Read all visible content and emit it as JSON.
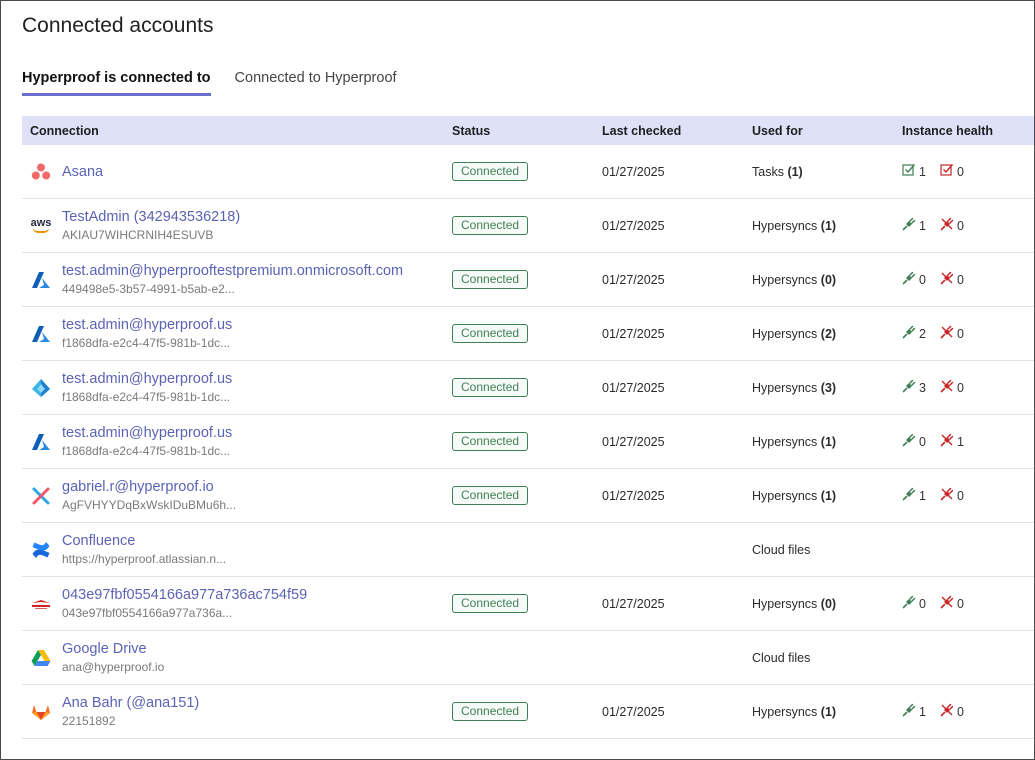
{
  "page": {
    "title": "Connected accounts"
  },
  "tabs": [
    {
      "label": "Hyperproof is connected to",
      "active": true
    },
    {
      "label": "Connected to Hyperproof",
      "active": false
    }
  ],
  "table": {
    "headers": {
      "connection": "Connection",
      "status": "Status",
      "last_checked": "Last checked",
      "used_for": "Used for",
      "instance_health": "Instance health"
    },
    "rows": [
      {
        "icon": "asana-icon",
        "name": "Asana",
        "sub": "",
        "status": "Connected",
        "last_checked": "01/27/2025",
        "used_for": "Tasks",
        "used_count": "(1)",
        "health_type": "tasks",
        "health_ok": "1",
        "health_err": "0"
      },
      {
        "icon": "aws-icon",
        "name": "TestAdmin (342943536218)",
        "sub": "AKIAU7WIHCRNIH4ESUVB",
        "status": "Connected",
        "last_checked": "01/27/2025",
        "used_for": "Hypersyncs",
        "used_count": "(1)",
        "health_type": "sync",
        "health_ok": "1",
        "health_err": "0"
      },
      {
        "icon": "azure-icon",
        "name": "test.admin@hyperprooftestpremium.onmicrosoft.com",
        "sub": "449498e5-3b57-4991-b5ab-e2...",
        "status": "Connected",
        "last_checked": "01/27/2025",
        "used_for": "Hypersyncs",
        "used_count": "(0)",
        "health_type": "sync",
        "health_ok": "0",
        "health_err": "0"
      },
      {
        "icon": "azure-icon",
        "name": "test.admin@hyperproof.us",
        "sub": "f1868dfa-e2c4-47f5-981b-1dc...",
        "status": "Connected",
        "last_checked": "01/27/2025",
        "used_for": "Hypersyncs",
        "used_count": "(2)",
        "health_type": "sync",
        "health_ok": "2",
        "health_err": "0"
      },
      {
        "icon": "azure-ad-icon",
        "name": "test.admin@hyperproof.us",
        "sub": "f1868dfa-e2c4-47f5-981b-1dc...",
        "status": "Connected",
        "last_checked": "01/27/2025",
        "used_for": "Hypersyncs",
        "used_count": "(3)",
        "health_type": "sync",
        "health_ok": "3",
        "health_err": "0"
      },
      {
        "icon": "azure-icon",
        "name": "test.admin@hyperproof.us",
        "sub": "f1868dfa-e2c4-47f5-981b-1dc...",
        "status": "Connected",
        "last_checked": "01/27/2025",
        "used_for": "Hypersyncs",
        "used_count": "(1)",
        "health_type": "sync",
        "health_ok": "0",
        "health_err": "1"
      },
      {
        "icon": "cross-logo-icon",
        "name": "gabriel.r@hyperproof.io",
        "sub": "AgFVHYYDqBxWskIDuBMu6h...",
        "status": "Connected",
        "last_checked": "01/27/2025",
        "used_for": "Hypersyncs",
        "used_count": "(1)",
        "health_type": "sync",
        "health_ok": "1",
        "health_err": "0"
      },
      {
        "icon": "confluence-icon",
        "name": "Confluence",
        "sub": "https://hyperproof.atlassian.n...",
        "status": "",
        "last_checked": "",
        "used_for": "Cloud files",
        "used_count": "",
        "health_type": "none",
        "health_ok": "",
        "health_err": ""
      },
      {
        "icon": "red-brand-icon",
        "name": "043e97fbf0554166a977a736ac754f59",
        "sub": "043e97fbf0554166a977a736a...",
        "status": "Connected",
        "last_checked": "01/27/2025",
        "used_for": "Hypersyncs",
        "used_count": "(0)",
        "health_type": "sync",
        "health_ok": "0",
        "health_err": "0"
      },
      {
        "icon": "google-drive-icon",
        "name": "Google Drive",
        "sub": "ana@hyperproof.io",
        "status": "",
        "last_checked": "",
        "used_for": "Cloud files",
        "used_count": "",
        "health_type": "none",
        "health_ok": "",
        "health_err": ""
      },
      {
        "icon": "gitlab-icon",
        "name": "Ana Bahr (@ana151)",
        "sub": "22151892",
        "status": "Connected",
        "last_checked": "01/27/2025",
        "used_for": "Hypersyncs",
        "used_count": "(1)",
        "health_type": "sync",
        "health_ok": "1",
        "health_err": "0"
      }
    ]
  },
  "colors": {
    "accent": "#6b6fd0",
    "link": "#5b63b5",
    "header_bg": "#dfe1f8",
    "status_green": "#3f7f55",
    "error_red": "#c62828",
    "ok_green": "#3f7f55"
  }
}
